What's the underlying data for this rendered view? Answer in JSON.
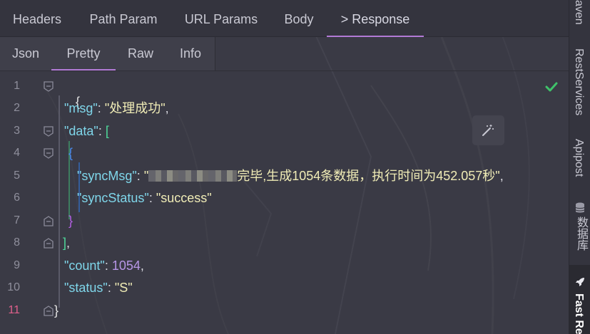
{
  "top_tabs": [
    {
      "label": "Headers"
    },
    {
      "label": "Path Param"
    },
    {
      "label": "URL Params"
    },
    {
      "label": "Body"
    },
    {
      "label": "> Response",
      "active": true
    }
  ],
  "sub_tabs": [
    {
      "label": "Json"
    },
    {
      "label": "Pretty",
      "active": true
    },
    {
      "label": "Raw"
    },
    {
      "label": "Info"
    }
  ],
  "editor": {
    "current_line": "11",
    "line_numbers": [
      "1",
      "2",
      "3",
      "4",
      "5",
      "6",
      "7",
      "8",
      "9",
      "10",
      "11"
    ],
    "lines": {
      "l1": {
        "brace": "{"
      },
      "l2": {
        "key": "\"msg\"",
        "colon": ": ",
        "value": "\"处理成功\"",
        "comma": ","
      },
      "l3": {
        "key": "\"data\"",
        "colon": ": ",
        "bracket": "["
      },
      "l4": {
        "brace": "{"
      },
      "l5": {
        "key": "\"syncMsg\"",
        "colon": ": ",
        "quote_open": "\"",
        "value_tail": "完毕,生成1054条数据，执行时间为452.057秒\"",
        "comma": ","
      },
      "l6": {
        "key": "\"syncStatus\"",
        "colon": ": ",
        "value": "\"success\""
      },
      "l7": {
        "brace": "}"
      },
      "l8": {
        "bracket": "]",
        "comma": ","
      },
      "l9": {
        "key": "\"count\"",
        "colon": ": ",
        "value": "1054",
        "comma": ","
      },
      "l10": {
        "key": "\"status\"",
        "colon": ": ",
        "value": "\"S\""
      },
      "l11": {
        "brace": "}"
      }
    }
  },
  "right_sidebar": [
    {
      "label": "aven"
    },
    {
      "label": "RestServices"
    },
    {
      "label": "Apipost"
    },
    {
      "label": "数据库"
    },
    {
      "label": "Fast Re",
      "active": true
    }
  ],
  "colors": {
    "accent": "#b27ad6",
    "key": "#7fd6ea",
    "string": "#f0ecb6",
    "number": "#b796e6",
    "success_check": "#3fc26a"
  }
}
